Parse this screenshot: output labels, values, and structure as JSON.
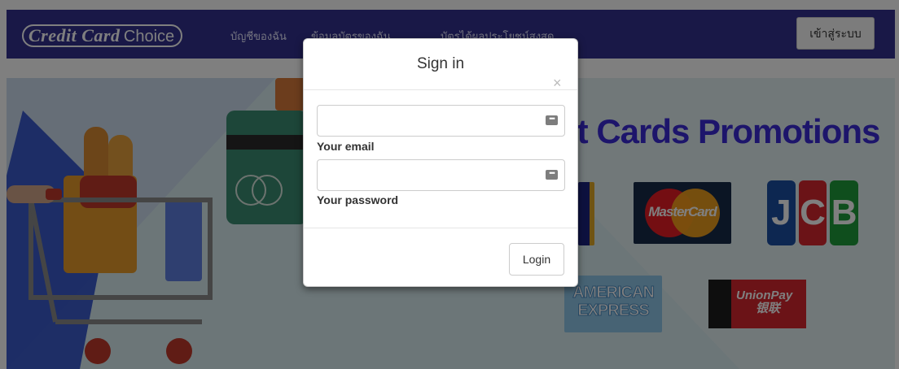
{
  "navbar": {
    "brand_bold": "Credit Card",
    "brand_light": "Choice",
    "links": [
      "บัญชีของฉัน",
      "ข้อมูลบัตรของฉัน",
      "บัตรได้ผลประโยชน์สูงสุด"
    ],
    "login_label": "เข้าสู่ระบบ"
  },
  "banner": {
    "headline": "it Cards Promotions",
    "cards": {
      "mastercard": "MasterCard",
      "jcb": [
        "J",
        "C",
        "B"
      ],
      "amex": [
        "AMERICAN",
        "EXPRESS"
      ],
      "unionpay": [
        "UnionPay",
        "银联"
      ]
    }
  },
  "modal": {
    "title": "Sign in",
    "close_symbol": "×",
    "email_label": "Your email",
    "email_value": "",
    "password_label": "Your password",
    "password_value": "",
    "login_button": "Login"
  },
  "colors": {
    "navbar_bg": "#33318f",
    "promo_text": "#3a2bd6",
    "overlay": "rgba(0,0,0,0.5)"
  },
  "icons": {
    "password_manager": "password-manager-icon",
    "close": "close-icon"
  }
}
